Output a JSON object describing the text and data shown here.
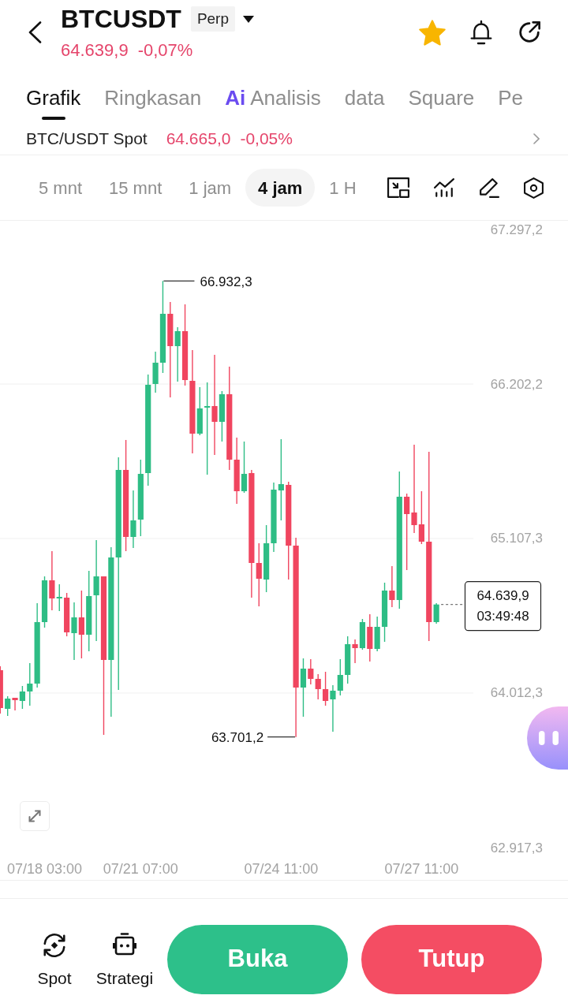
{
  "header": {
    "title": "BTCUSDT",
    "badge": "Perp",
    "price": "64.639,9",
    "change": "-0,07%",
    "favorite": true
  },
  "tabs": [
    {
      "label": "Grafik",
      "selected": true,
      "kind": "text"
    },
    {
      "label": "Ringkasan",
      "selected": false,
      "kind": "text"
    },
    {
      "label": "Analisis",
      "selected": false,
      "kind": "ai",
      "prefix": "Ai"
    },
    {
      "label": "data",
      "selected": false,
      "kind": "text"
    },
    {
      "label": "Square",
      "selected": false,
      "kind": "text"
    },
    {
      "label": "Pe",
      "selected": false,
      "kind": "text"
    }
  ],
  "spot_row": {
    "pair": "BTC/USDT Spot",
    "price": "64.665,0",
    "change": "-0,05%"
  },
  "timeframes": [
    {
      "label": "5 mnt",
      "selected": false
    },
    {
      "label": "15 mnt",
      "selected": false
    },
    {
      "label": "1 jam",
      "selected": false
    },
    {
      "label": "4 jam",
      "selected": true
    },
    {
      "label": "1 H",
      "selected": false
    }
  ],
  "chart": {
    "high_label": "66.932,3",
    "low_label": "63.701,2",
    "last_price": "64.639,9",
    "countdown": "03:49:48",
    "chart_data": {
      "type": "candlestick",
      "categories": [
        null,
        null,
        null,
        null,
        null,
        null,
        "07/18 03:00",
        null,
        null,
        null,
        null,
        null,
        null,
        null,
        null,
        null,
        null,
        null,
        null,
        "07/21 07:00",
        null,
        null,
        null,
        null,
        null,
        null,
        null,
        null,
        null,
        null,
        null,
        null,
        null,
        null,
        null,
        null,
        null,
        null,
        "07/24 11:00",
        null,
        null,
        null,
        null,
        null,
        null,
        null,
        null,
        null,
        null,
        null,
        null,
        null,
        null,
        null,
        null,
        null,
        null,
        "07/27 11:00",
        null,
        null
      ],
      "ohlc": [
        [
          64174.3,
          64202.3,
          63867.1,
          63906.2
        ],
        [
          63900.6,
          63990.0,
          63850.3,
          63973.2
        ],
        [
          63978.8,
          63978.8,
          63889.4,
          63962.1
        ],
        [
          63956.5,
          64062.6,
          63900.6,
          64023.5
        ],
        [
          64023.5,
          64224.6,
          63922.9,
          64079.4
        ],
        [
          64079.4,
          64649.2,
          64051.4,
          64515.1
        ],
        [
          64515.1,
          64839.2,
          64476.0,
          64811.2
        ],
        [
          64811.2,
          65017.9,
          64598.9,
          64682.7
        ],
        [
          64682.7,
          64783.3,
          64593.3,
          64693.9
        ],
        [
          64688.3,
          64721.8,
          64414.6,
          64442.5
        ],
        [
          64436.9,
          64654.8,
          64247.0,
          64548.6
        ],
        [
          64548.6,
          64738.6,
          64258.1,
          64425.7
        ],
        [
          64425.7,
          64878.3,
          64308.4,
          64699.5
        ],
        [
          64705.1,
          65096.1,
          64381.0,
          64839.2
        ],
        [
          64839.2,
          64839.2,
          63716.2,
          64247.0
        ],
        [
          64247.0,
          65045.9,
          63844.7,
          64973.2
        ],
        [
          64973.2,
          65682.7,
          64034.7,
          65593.3
        ],
        [
          65593.3,
          65805.6,
          65017.9,
          65118.5
        ],
        [
          65118.5,
          65448.1,
          65040.3,
          65235.8
        ],
        [
          65241.4,
          65666.0,
          65124.1,
          65565.4
        ],
        [
          65571.0,
          66269.3,
          65481.6,
          66196.7
        ],
        [
          66202.3,
          66431.3,
          66140.8,
          66353.1
        ],
        [
          66353.1,
          66932.3,
          66280.5,
          66699.5
        ],
        [
          66699.5,
          66783.3,
          66107.3,
          66470.4
        ],
        [
          66470.4,
          66604.5,
          66219.0,
          66576.6
        ],
        [
          66576.6,
          66766.5,
          66191.1,
          66230.2
        ],
        [
          66224.6,
          66442.5,
          65710.7,
          65850.3
        ],
        [
          65850.3,
          66179.9,
          65839.2,
          66029.1
        ],
        [
          66034.7,
          66213.5,
          65559.8,
          66045.9
        ],
        [
          66045.9,
          66409.0,
          65699.5,
          65934.1
        ],
        [
          65934.1,
          66152.0,
          65794.5,
          66129.7
        ],
        [
          66129.7,
          66325.2,
          65593.3,
          65666.0
        ],
        [
          65666.0,
          65822.4,
          65353.1,
          65442.5
        ],
        [
          65442.5,
          65794.5,
          65431.3,
          65565.4
        ],
        [
          65571.0,
          65593.3,
          64688.3,
          64934.1
        ],
        [
          64934.1,
          65073.8,
          64626.9,
          64822.4
        ],
        [
          64816.8,
          65202.3,
          64727.4,
          65073.8
        ],
        [
          65073.8,
          65504.0,
          65012.3,
          65453.7
        ],
        [
          65448.1,
          65811.2,
          65235.8,
          65492.8
        ],
        [
          65487.2,
          65509.5,
          64816.8,
          65057.0
        ],
        [
          65057.0,
          65112.9,
          63701.2,
          64051.4
        ],
        [
          64051.4,
          64258.1,
          63844.7,
          64185.5
        ],
        [
          64185.5,
          64252.6,
          64073.8,
          64112.9
        ],
        [
          64112.9,
          64146.4,
          63967.6,
          64040.3
        ],
        [
          64040.3,
          64163.2,
          63922.9,
          63956.5
        ],
        [
          63967.6,
          64068.2,
          63738.6,
          64029.1
        ],
        [
          64029.1,
          64252.6,
          63995.6,
          64140.8
        ],
        [
          64140.8,
          64414.6,
          64079.4,
          64358.7
        ],
        [
          64358.7,
          64392.2,
          64224.6,
          64330.8
        ],
        [
          64330.8,
          64537.5,
          64319.6,
          64515.1
        ],
        [
          64481.6,
          64571.0,
          64235.8,
          64325.2
        ],
        [
          64325.2,
          64554.2,
          64308.4,
          64481.6
        ],
        [
          64481.6,
          64794.5,
          64375.5,
          64738.6
        ],
        [
          64738.6,
          64911.8,
          64621.3,
          64671.6
        ],
        [
          64671.6,
          65582.2,
          64610.1,
          65403.4
        ],
        [
          65403.4,
          65425.7,
          64883.8,
          65280.5
        ],
        [
          65291.7,
          65772.1,
          65146.4,
          65202.3
        ],
        [
          65207.9,
          65442.5,
          65068.2,
          65085.0
        ],
        [
          65085.0,
          65721.8,
          64381.0,
          64515.1
        ],
        [
          64515.1,
          64649.2,
          64504.0,
          64639.9
        ]
      ],
      "ylim": [
        62917.3,
        67297.2
      ],
      "grid": true,
      "yticks": [
        {
          "value": 67297.2,
          "label": "67.297,2"
        },
        {
          "value": 66202.2,
          "label": "66.202,2"
        },
        {
          "value": 65107.3,
          "label": "65.107,3"
        },
        {
          "value": 64012.3,
          "label": "64.012,3"
        },
        {
          "value": 62917.3,
          "label": "62.917,3"
        }
      ]
    }
  },
  "bottom_bar": {
    "shortcuts": [
      {
        "label": "Spot",
        "kind": "spot"
      },
      {
        "label": "Strategi",
        "kind": "strategy"
      }
    ],
    "buttons": [
      {
        "label": "Buka",
        "kind": "open"
      },
      {
        "label": "Tutup",
        "kind": "close"
      }
    ]
  }
}
